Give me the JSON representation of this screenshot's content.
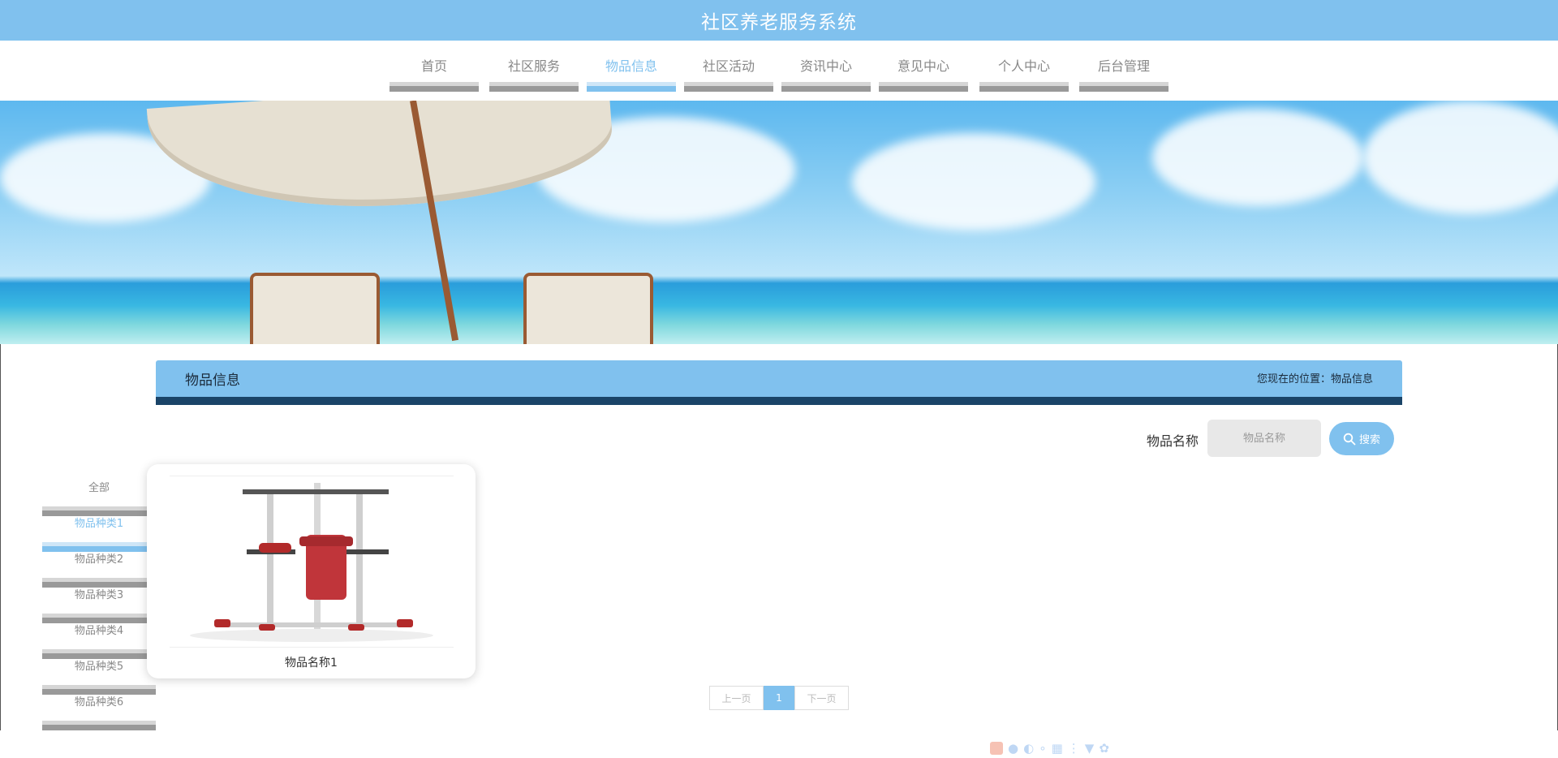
{
  "header": {
    "title": "社区养老服务系统"
  },
  "nav": {
    "items": [
      {
        "label": "首页"
      },
      {
        "label": "社区服务"
      },
      {
        "label": "物品信息"
      },
      {
        "label": "社区活动"
      },
      {
        "label": "资讯中心"
      },
      {
        "label": "意见中心"
      },
      {
        "label": "个人中心"
      },
      {
        "label": "后台管理"
      }
    ],
    "active_index": 2
  },
  "section": {
    "title": "物品信息",
    "breadcrumb": "您现在的位置：物品信息"
  },
  "search": {
    "label": "物品名称",
    "placeholder": "物品名称",
    "button_label": "搜索"
  },
  "categories": {
    "items": [
      {
        "label": "全部"
      },
      {
        "label": "物品种类1"
      },
      {
        "label": "物品种类2"
      },
      {
        "label": "物品种类3"
      },
      {
        "label": "物品种类4"
      },
      {
        "label": "物品种类5"
      },
      {
        "label": "物品种类6"
      }
    ],
    "active_index": 1
  },
  "products": [
    {
      "name": "物品名称1"
    }
  ],
  "pagination": {
    "prev_label": "上一页",
    "current_page": "1",
    "next_label": "下一页"
  },
  "colors": {
    "accent": "#80c1ee",
    "header_rule": "#1a4468",
    "inactive_text": "#888888"
  }
}
